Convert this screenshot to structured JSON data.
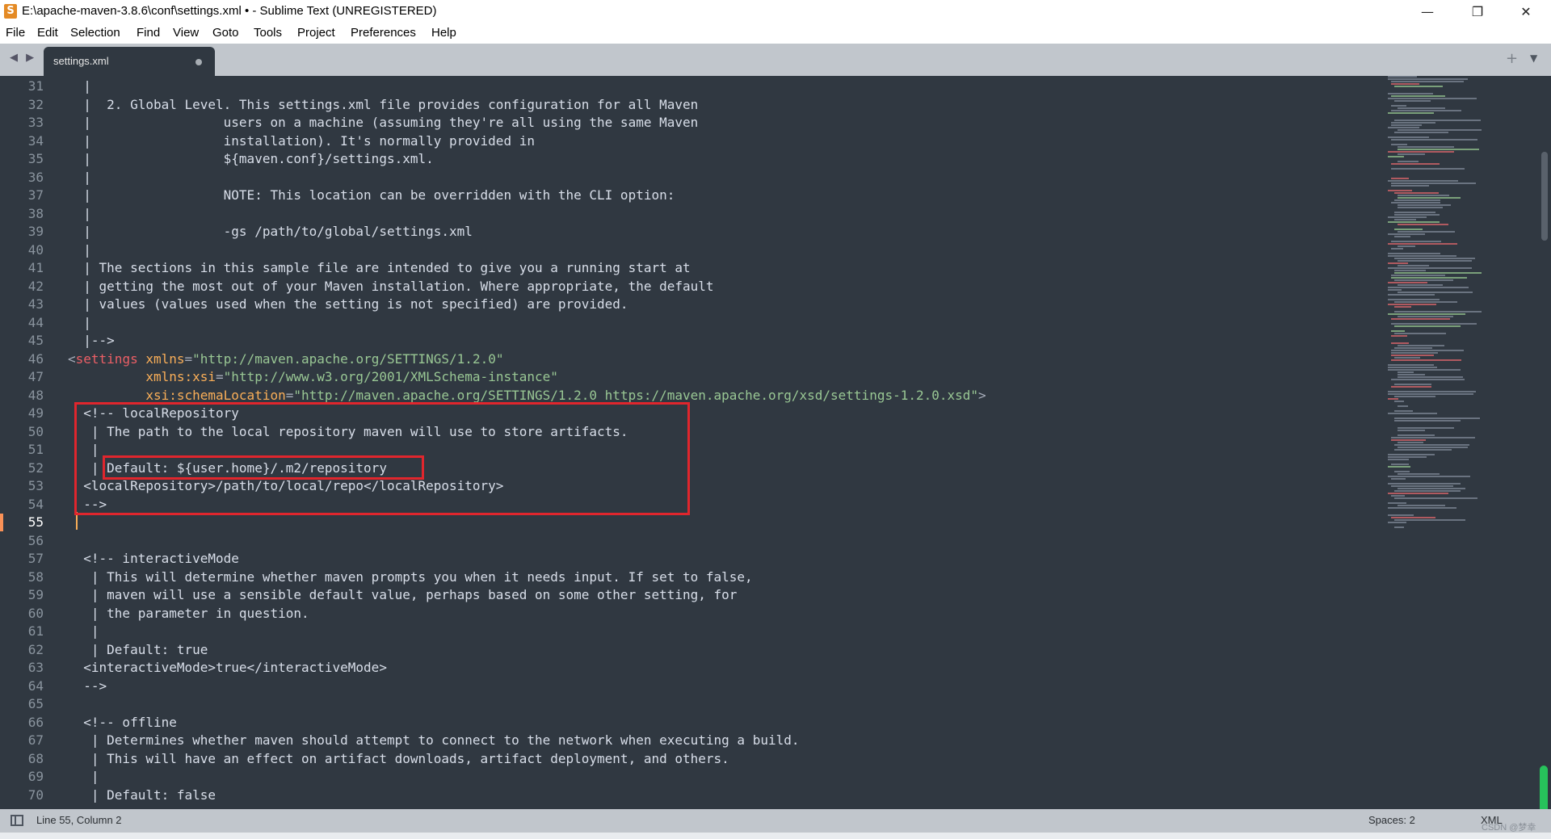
{
  "window": {
    "title": "E:\\apache-maven-3.8.6\\conf\\settings.xml • - Sublime Text (UNREGISTERED)",
    "app_icon_glyph": "S",
    "minimize_glyph": "—",
    "restore_glyph": "❐",
    "close_glyph": "✕"
  },
  "menu": [
    "File",
    "Edit",
    "Selection",
    "Find",
    "View",
    "Goto",
    "Tools",
    "Project",
    "Preferences",
    "Help"
  ],
  "tabs": {
    "nav": "◀ ▶",
    "active": "settings.xml",
    "modified": true,
    "new_tab": "+",
    "dropdown": "▼"
  },
  "editor": {
    "first_line": 31,
    "current_line": 55,
    "line_numbers": [
      "31",
      "32",
      "33",
      "34",
      "35",
      "36",
      "37",
      "38",
      "39",
      "40",
      "41",
      "42",
      "43",
      "44",
      "45",
      "46",
      "47",
      "48",
      "49",
      "50",
      "51",
      "52",
      "53",
      "54",
      "55",
      "56",
      "57",
      "58",
      "59",
      "60",
      "61",
      "62",
      "63",
      "64",
      "65",
      "66",
      "67",
      "68",
      "69",
      "70"
    ],
    "lines": [
      "  |",
      "  |  2. Global Level. This settings.xml file provides configuration for all Maven",
      "  |                 users on a machine (assuming they're all using the same Maven",
      "  |                 installation). It's normally provided in",
      "  |                 ${maven.conf}/settings.xml.",
      "  |",
      "  |                 NOTE: This location can be overridden with the CLI option:",
      "  |",
      "  |                 -gs /path/to/global/settings.xml",
      "  |",
      "  | The sections in this sample file are intended to give you a running start at",
      "  | getting the most out of your Maven installation. Where appropriate, the default",
      "  | values (values used when the setting is not specified) are provided.",
      "  |",
      "  |-->",
      "<settings xmlns=\"http://maven.apache.org/SETTINGS/1.2.0\"",
      "          xmlns:xsi=\"http://www.w3.org/2001/XMLSchema-instance\"",
      "          xsi:schemaLocation=\"http://maven.apache.org/SETTINGS/1.2.0 https://maven.apache.org/xsd/settings-1.2.0.xsd\">",
      "  <!-- localRepository",
      "   | The path to the local repository maven will use to store artifacts.",
      "   |",
      "   | Default: ${user.home}/.m2/repository",
      "  <localRepository>/path/to/local/repo</localRepository>",
      "  -->",
      "",
      "",
      "  <!-- interactiveMode",
      "   | This will determine whether maven prompts you when it needs input. If set to false,",
      "   | maven will use a sensible default value, perhaps based on some other setting, for",
      "   | the parameter in question.",
      "   |",
      "   | Default: true",
      "  <interactiveMode>true</interactiveMode>",
      "  -->",
      "",
      "  <!-- offline",
      "   | Determines whether maven should attempt to connect to the network when executing a build.",
      "   | This will have an effect on artifact downloads, artifact deployment, and others.",
      "   |",
      "   | Default: false"
    ],
    "settings_tag": {
      "open": "<",
      "name": "settings",
      "line1_attr": "xmlns",
      "line1_val": "\"http://maven.apache.org/SETTINGS/1.2.0\"",
      "line2_attr": "xmlns:xsi",
      "line2_val": "\"http://www.w3.org/2001/XMLSchema-instance\"",
      "line3_attr": "xsi:schemaLocation",
      "line3_val": "\"http://maven.apache.org/SETTINGS/1.2.0 https://maven.apache.org/xsd/settings-1.2.0.xsd\"",
      "close": ">",
      "eq": "="
    },
    "colors": {
      "background": "#303841",
      "text": "#d8dee9",
      "tag": "#ec5f66",
      "attribute": "#f9ae58",
      "string": "#99c794",
      "highlight_box": "#e0262d"
    }
  },
  "statusbar": {
    "position": "Line 55, Column 2",
    "indent": "Spaces: 2",
    "syntax": "XML"
  },
  "watermark": "CSDN @梦幸"
}
